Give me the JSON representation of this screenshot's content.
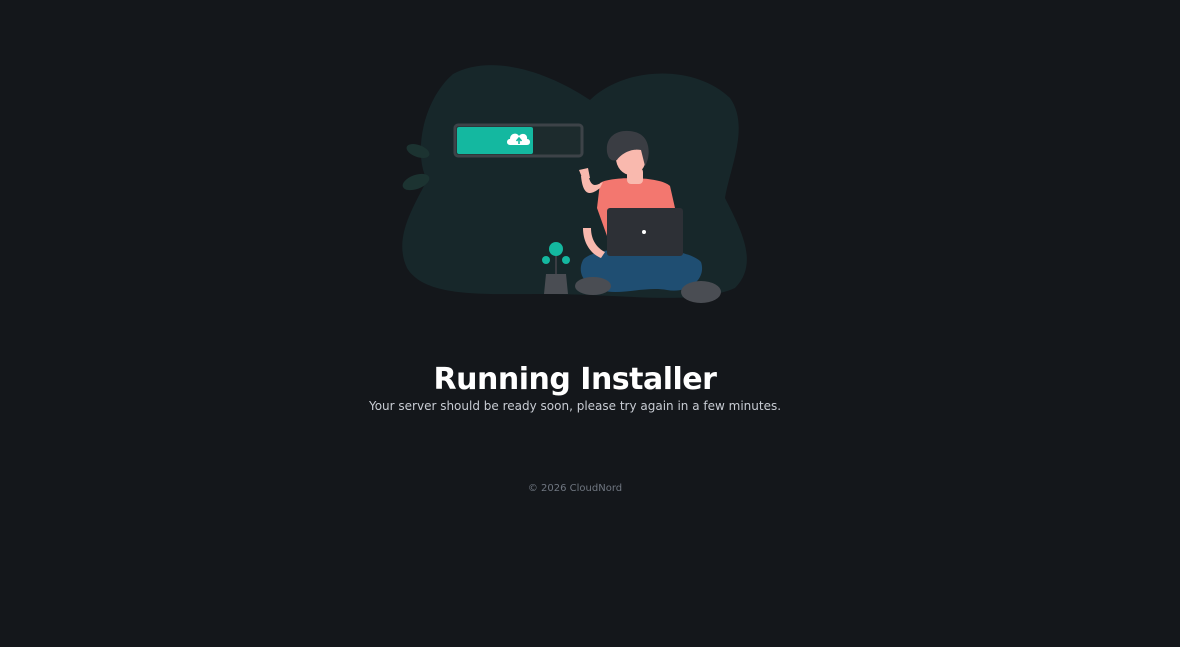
{
  "main": {
    "title": "Running Installer",
    "message": "Your server should be ready soon, please try again in a few minutes."
  },
  "illustration": {
    "progress_fraction": 0.62,
    "icon": "cloud-upload-icon",
    "colors": {
      "blob": "#17272a",
      "accent": "#14b8a0",
      "shirt": "#f3776f",
      "skin": "#f9b9ae",
      "hair": "#3a3d43",
      "pants": "#1f4e72",
      "laptop": "#2d3036",
      "shoes": "#4a4d53"
    }
  },
  "footer": {
    "copyright": "© 2026 CloudNord"
  }
}
